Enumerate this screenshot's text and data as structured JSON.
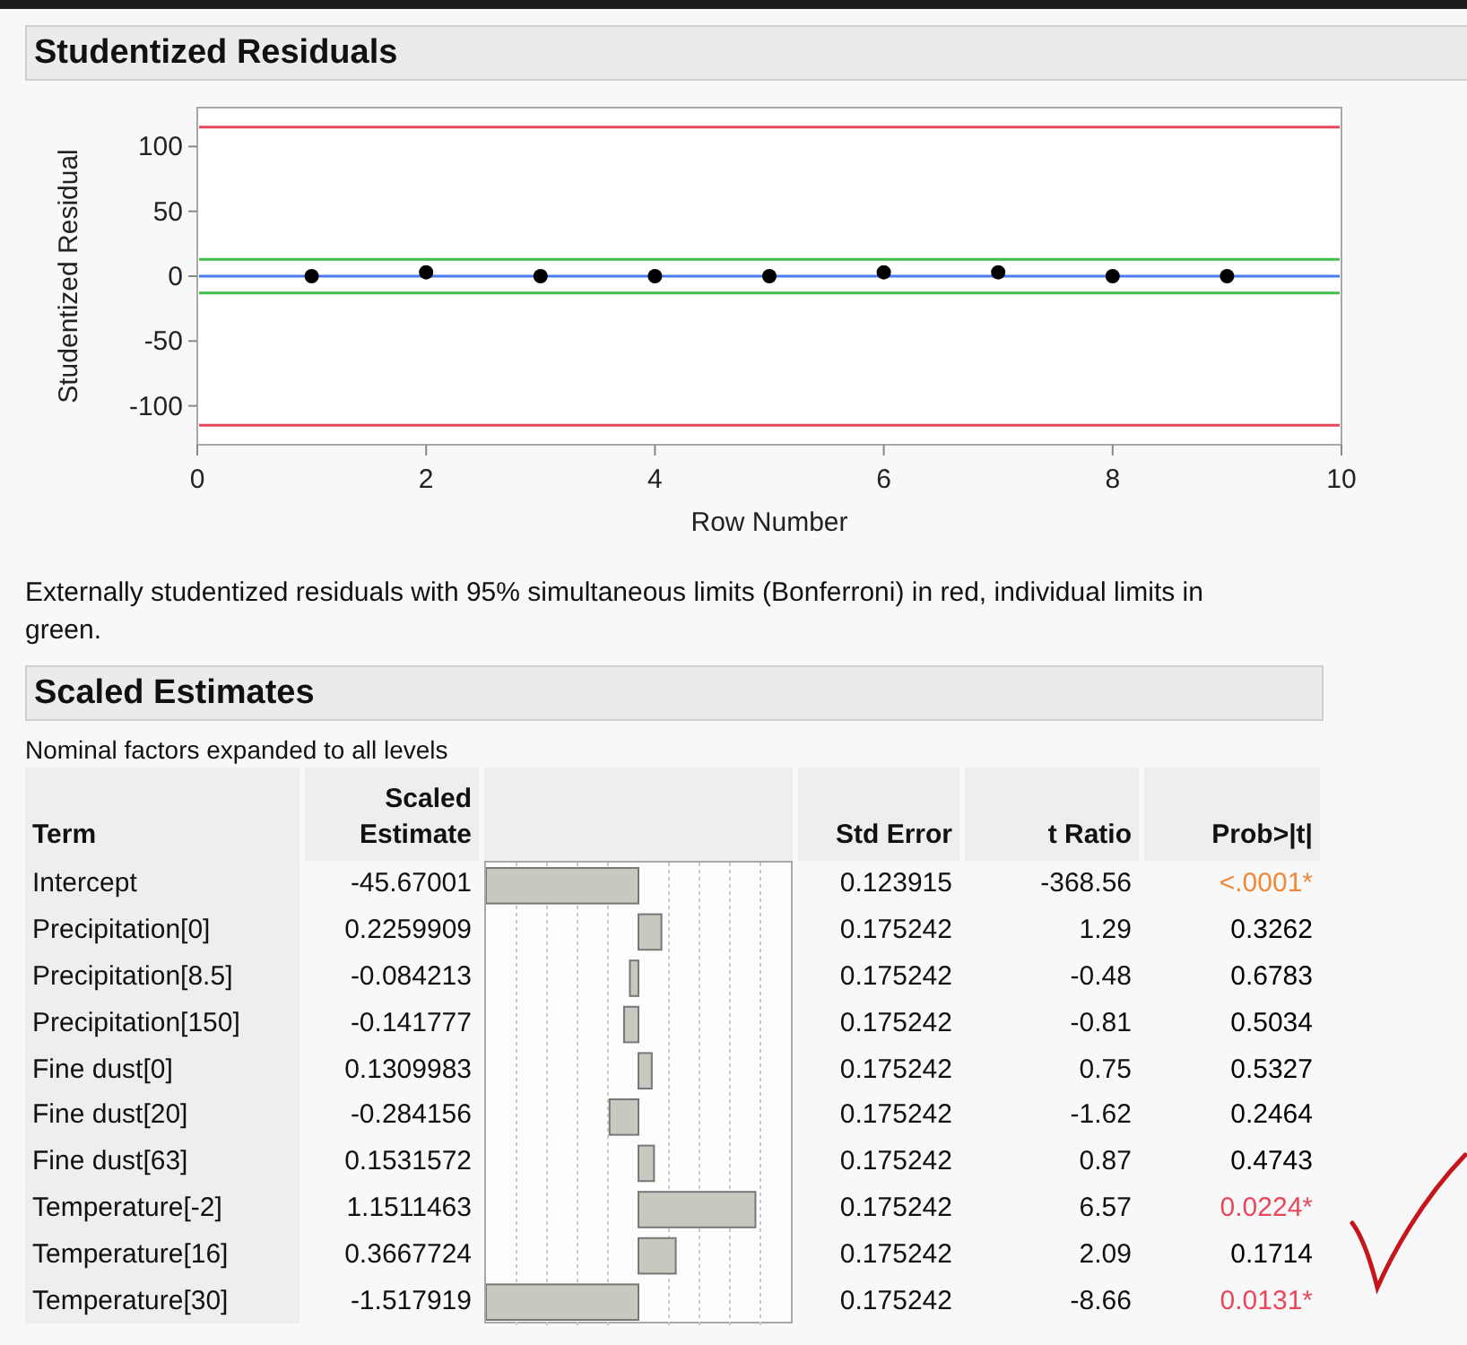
{
  "residuals": {
    "title": "Studentized Residuals",
    "chart_data": {
      "type": "scatter",
      "xlabel": "Row Number",
      "ylabel": "Studentized Residual",
      "xlim": [
        0,
        10
      ],
      "ylim": [
        -130,
        130
      ],
      "xticks": [
        0,
        2,
        4,
        6,
        8,
        10
      ],
      "yticks": [
        -100,
        -50,
        0,
        50,
        100
      ],
      "x": [
        1,
        2,
        3,
        4,
        5,
        6,
        7,
        8,
        9
      ],
      "series": [
        {
          "color": "#000000",
          "values": [
            0,
            3,
            0,
            0,
            0,
            3,
            3,
            0,
            0
          ]
        }
      ],
      "ref_lines": [
        {
          "axis": "y",
          "value": 115,
          "color": "#e8485a"
        },
        {
          "axis": "y",
          "value": -115,
          "color": "#e8485a"
        },
        {
          "axis": "y",
          "value": 13,
          "color": "#3cc04a"
        },
        {
          "axis": "y",
          "value": -13,
          "color": "#3cc04a"
        },
        {
          "axis": "y",
          "value": 0,
          "color": "#4a7cf0"
        }
      ]
    },
    "caption": "Externally studentized residuals with 95% simultaneous limits (Bonferroni) in red, individual limits in green."
  },
  "scaled_estimates": {
    "title": "Scaled Estimates",
    "subtitle": "Nominal factors expanded to all levels",
    "columns": [
      "Term",
      "Scaled Estimate",
      "Std Error",
      "t Ratio",
      "Prob>|t|"
    ],
    "rows": [
      {
        "term": "Intercept",
        "estimate": "-45.67001",
        "std_error": "0.123915",
        "t_ratio": "-368.56",
        "prob": "<.0001*",
        "color": "#f0883a"
      },
      {
        "term": "Precipitation[0]",
        "estimate": "0.2259909",
        "std_error": "0.175242",
        "t_ratio": "1.29",
        "prob": "0.3262",
        "color": "#000000"
      },
      {
        "term": "Precipitation[8.5]",
        "estimate": "-0.084213",
        "std_error": "0.175242",
        "t_ratio": "-0.48",
        "prob": "0.6783",
        "color": "#000000"
      },
      {
        "term": "Precipitation[150]",
        "estimate": "-0.141777",
        "std_error": "0.175242",
        "t_ratio": "-0.81",
        "prob": "0.5034",
        "color": "#000000"
      },
      {
        "term": "Fine dust[0]",
        "estimate": "0.1309983",
        "std_error": "0.175242",
        "t_ratio": "0.75",
        "prob": "0.5327",
        "color": "#000000"
      },
      {
        "term": "Fine dust[20]",
        "estimate": "-0.284156",
        "std_error": "0.175242",
        "t_ratio": "-1.62",
        "prob": "0.2464",
        "color": "#000000"
      },
      {
        "term": "Fine dust[63]",
        "estimate": "0.1531572",
        "std_error": "0.175242",
        "t_ratio": "0.87",
        "prob": "0.4743",
        "color": "#000000"
      },
      {
        "term": "Temperature[-2]",
        "estimate": "1.1511463",
        "std_error": "0.175242",
        "t_ratio": "6.57",
        "prob": "0.0224*",
        "color": "#e8485a"
      },
      {
        "term": "Temperature[16]",
        "estimate": "0.3667724",
        "std_error": "0.175242",
        "t_ratio": "2.09",
        "prob": "0.1714",
        "color": "#000000"
      },
      {
        "term": "Temperature[30]",
        "estimate": "-1.517919",
        "std_error": "0.175242",
        "t_ratio": "-8.66",
        "prob": "0.0131*",
        "color": "#e8485a"
      }
    ]
  }
}
